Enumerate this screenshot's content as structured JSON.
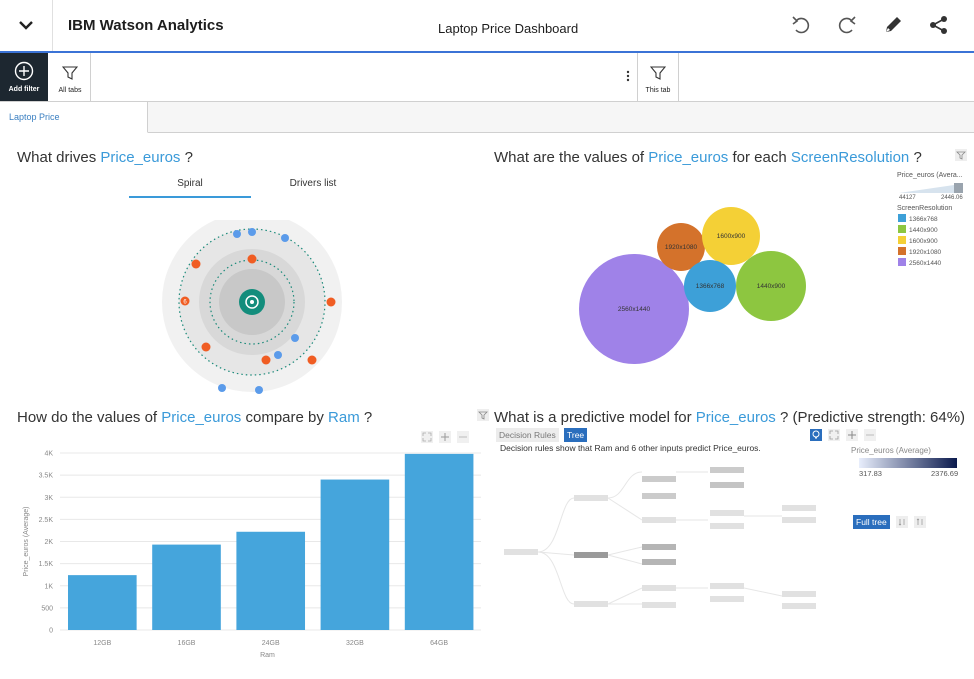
{
  "header": {
    "app_title": "IBM Watson Analytics",
    "dashboard_title": "Laptop Price Dashboard"
  },
  "filterbar": {
    "add_filter": "Add filter",
    "all_tabs": "All tabs",
    "this_tab": "This tab"
  },
  "tabs": [
    {
      "label": "Laptop Price"
    }
  ],
  "panel_drivers": {
    "title_pre": "What drives",
    "title_kw": "Price_euros",
    "title_post": "?",
    "view_spiral": "Spiral",
    "view_drivers_list": "Drivers list",
    "spiral_marker": "6"
  },
  "panel_bubbles": {
    "title_pre": "What are the values of",
    "title_kw1": "Price_euros",
    "title_mid": "for each",
    "title_kw2": "ScreenResolution",
    "title_post": "?",
    "legend_size_title": "Price_euros (Avera...",
    "legend_size_min": "44127",
    "legend_size_max": "2446.06",
    "legend_color_title": "ScreenResolution",
    "legend_items": [
      {
        "label": "1366x768",
        "color": "#3da0d8"
      },
      {
        "label": "1440x900",
        "color": "#8dc640"
      },
      {
        "label": "1600x900",
        "color": "#f4d036"
      },
      {
        "label": "1920x1080",
        "color": "#d4722b"
      },
      {
        "label": "2560x1440",
        "color": "#9f82e8"
      }
    ],
    "bubbles": [
      {
        "label": "2560x1440",
        "color": "#9f82e8"
      },
      {
        "label": "1920x1080",
        "color": "#d4722b"
      },
      {
        "label": "1600x900",
        "color": "#f4d036"
      },
      {
        "label": "1366x768",
        "color": "#3da0d8"
      },
      {
        "label": "1440x900",
        "color": "#8dc640"
      }
    ]
  },
  "panel_bar": {
    "title_pre": "How do the values of",
    "title_kw1": "Price_euros",
    "title_mid": "compare by",
    "title_kw2": "Ram",
    "title_post": "?"
  },
  "chart_data": {
    "type": "bar",
    "categories": [
      "12GB",
      "16GB",
      "24GB",
      "32GB",
      "64GB"
    ],
    "values": [
      1240,
      1930,
      2220,
      3400,
      3980
    ],
    "xlabel": "Ram",
    "ylabel": "Price_euros (Average)",
    "ylim": [
      0,
      4000
    ],
    "yticks": [
      "0",
      "500",
      "1K",
      "1.5K",
      "2K",
      "2.5K",
      "3K",
      "3.5K",
      "4K"
    ],
    "color": "#45a5dc",
    "grid": true
  },
  "panel_model": {
    "title_pre": "What is a predictive model for",
    "title_kw": "Price_euros",
    "title_post": "? (Predictive strength: 64%)",
    "tab_rules": "Decision Rules",
    "tab_tree": "Tree",
    "description": "Decision rules show that Ram and 6 other inputs predict Price_euros.",
    "legend_title": "Price_euros (Average)",
    "legend_min": "317.83",
    "legend_max": "2376.69",
    "full_tree": "Full tree"
  },
  "colors": {
    "accent": "#3b73d6",
    "keyword": "#3a9ad9",
    "teal": "#138d7c",
    "orange": "#f05d23",
    "blue_dot": "#5b9bea"
  }
}
